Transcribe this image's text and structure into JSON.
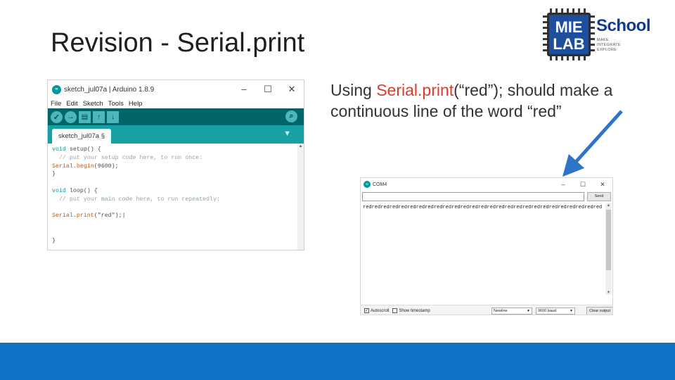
{
  "slide": {
    "title": "Revision - Serial.print",
    "description_prefix": "Using ",
    "description_highlight": "Serial.print",
    "description_suffix": "(“red”); should make a continuous line of the word “red”",
    "footer_color": "#0f72c4"
  },
  "logo": {
    "chip_line1": "MIE",
    "chip_line2": "LAB",
    "school": "School",
    "tagline": [
      "MAKE",
      "INTEGRATE",
      "EXPLORE"
    ]
  },
  "ide": {
    "window_title": "sketch_jul07a | Arduino 1.8.9",
    "window_buttons": [
      "–",
      "☐",
      "✕"
    ],
    "menu": [
      "File",
      "Edit",
      "Sketch",
      "Tools",
      "Help"
    ],
    "toolbar_icons": [
      "verify-icon",
      "upload-icon",
      "new-icon",
      "open-icon",
      "save-icon",
      "serial-monitor-icon"
    ],
    "tab_label": "sketch_jul07a §",
    "code": {
      "l1_kw": "void",
      "l1_fn": "setup",
      "l1_rest": "() {",
      "l2": "  // put your setup code here, to run once:",
      "l3_obj": "Serial",
      "l3_fn": "begin",
      "l3_rest": "(9600);",
      "l4": "}",
      "l6_kw": "void",
      "l6_fn": "loop",
      "l6_rest": "() {",
      "l7": "  // put your main code here, to run repeatedly:",
      "l9_obj": "Serial",
      "l9_fn": "print",
      "l9_rest": "(\"red\");|",
      "l12": "}"
    },
    "accent": "#00979d"
  },
  "serial_monitor": {
    "window_title": "COM4",
    "window_buttons": [
      "–",
      "☐",
      "✕"
    ],
    "input_value": "",
    "send_label": "Send",
    "output": "redredredredredredredredredredredredredredredredredredredredredredredredredredredredredredredredredredredredredredredred",
    "autoscroll_label": "Autoscroll",
    "autoscroll_checked": true,
    "timestamp_label": "Show timestamp",
    "timestamp_checked": false,
    "line_ending": "Newline",
    "baud": "9600 baud",
    "clear_label": "Clear output"
  }
}
